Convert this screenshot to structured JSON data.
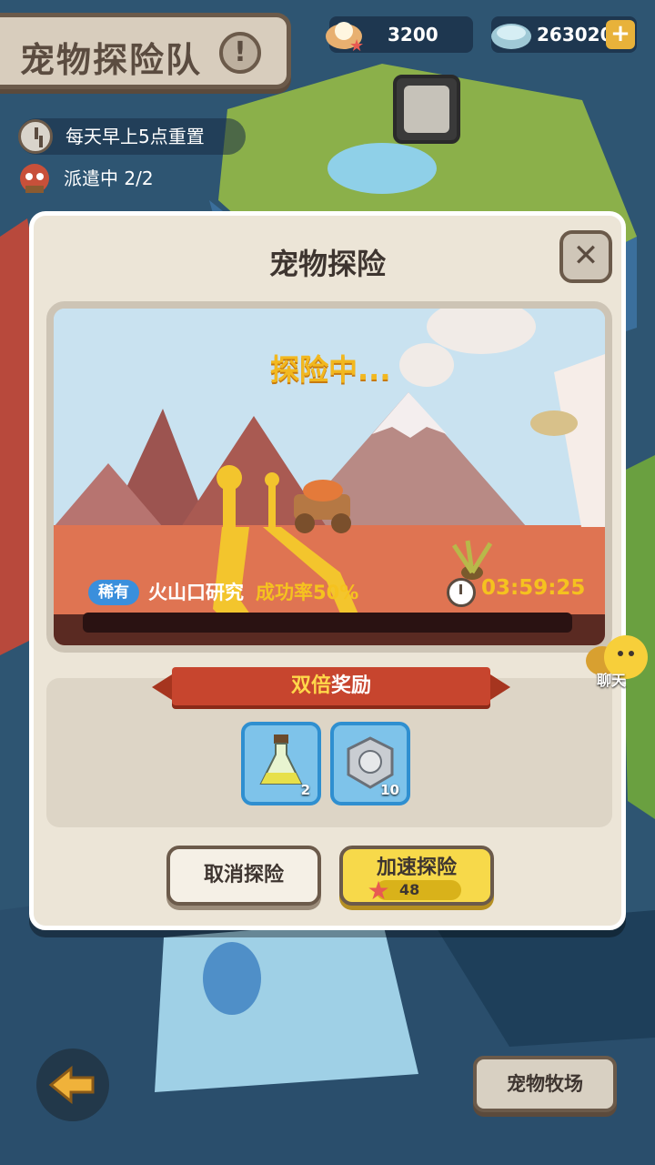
{
  "header": {
    "title": "宠物探险队",
    "info_label": "!"
  },
  "resources": {
    "starfish_count": "3200",
    "shell_count": "263020",
    "add_label": "+"
  },
  "info": {
    "reset_text": "每天早上5点重置",
    "dispatch_text": "派遣中 2/2"
  },
  "modal": {
    "title": "宠物探险",
    "close_label": "✕",
    "status": "探险中...",
    "rarity": "稀有",
    "mission_name": "火山口研究",
    "success_rate": "成功率50%",
    "timer": "03:59:25",
    "progress_fraction": 0.0,
    "reward_title_prefix": "双倍",
    "reward_title_suffix": "奖励",
    "rewards": [
      {
        "name": "potion-icon",
        "count": "2"
      },
      {
        "name": "medal-icon",
        "count": "10"
      }
    ],
    "cancel_label": "取消探险",
    "speedup_label": "加速探险",
    "speedup_cost": "48"
  },
  "chat_label": "聊天",
  "bottom": {
    "ranch_label": "宠物牧场"
  },
  "colors": {
    "accent_yellow": "#f5c21f",
    "rarity_blue": "#3a8fdc",
    "ribbon_red": "#c7452e"
  }
}
